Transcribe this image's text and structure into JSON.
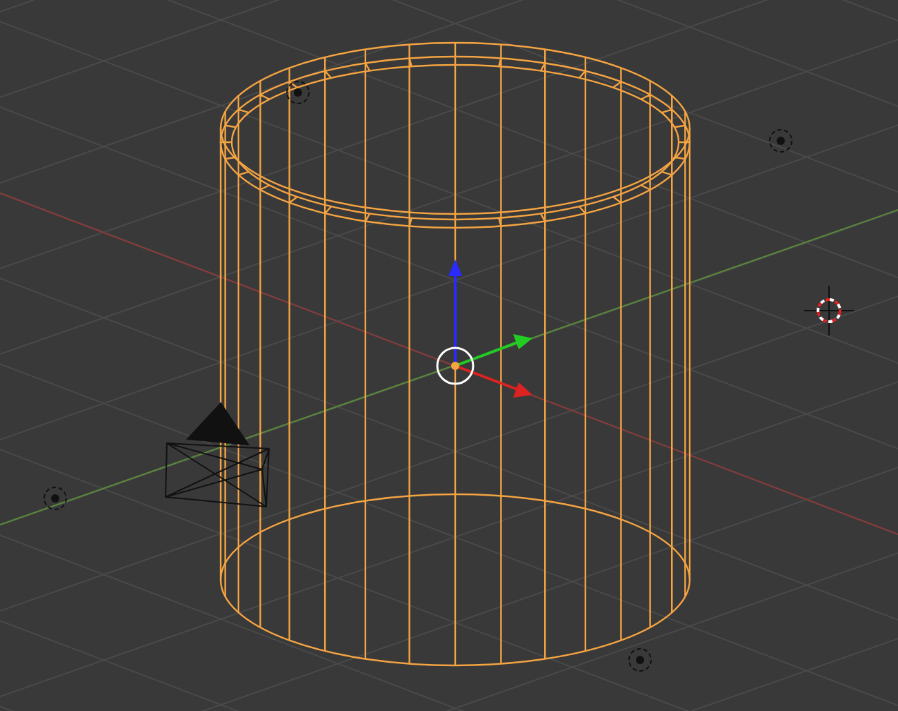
{
  "viewport": {
    "objects": [
      {
        "kind": "cylinder",
        "selected": true
      },
      {
        "kind": "camera",
        "selected": false
      },
      {
        "kind": "lamp",
        "selected": false
      },
      {
        "kind": "lamp",
        "selected": false
      },
      {
        "kind": "lamp",
        "selected": false
      },
      {
        "kind": "lamp",
        "selected": false
      }
    ]
  }
}
